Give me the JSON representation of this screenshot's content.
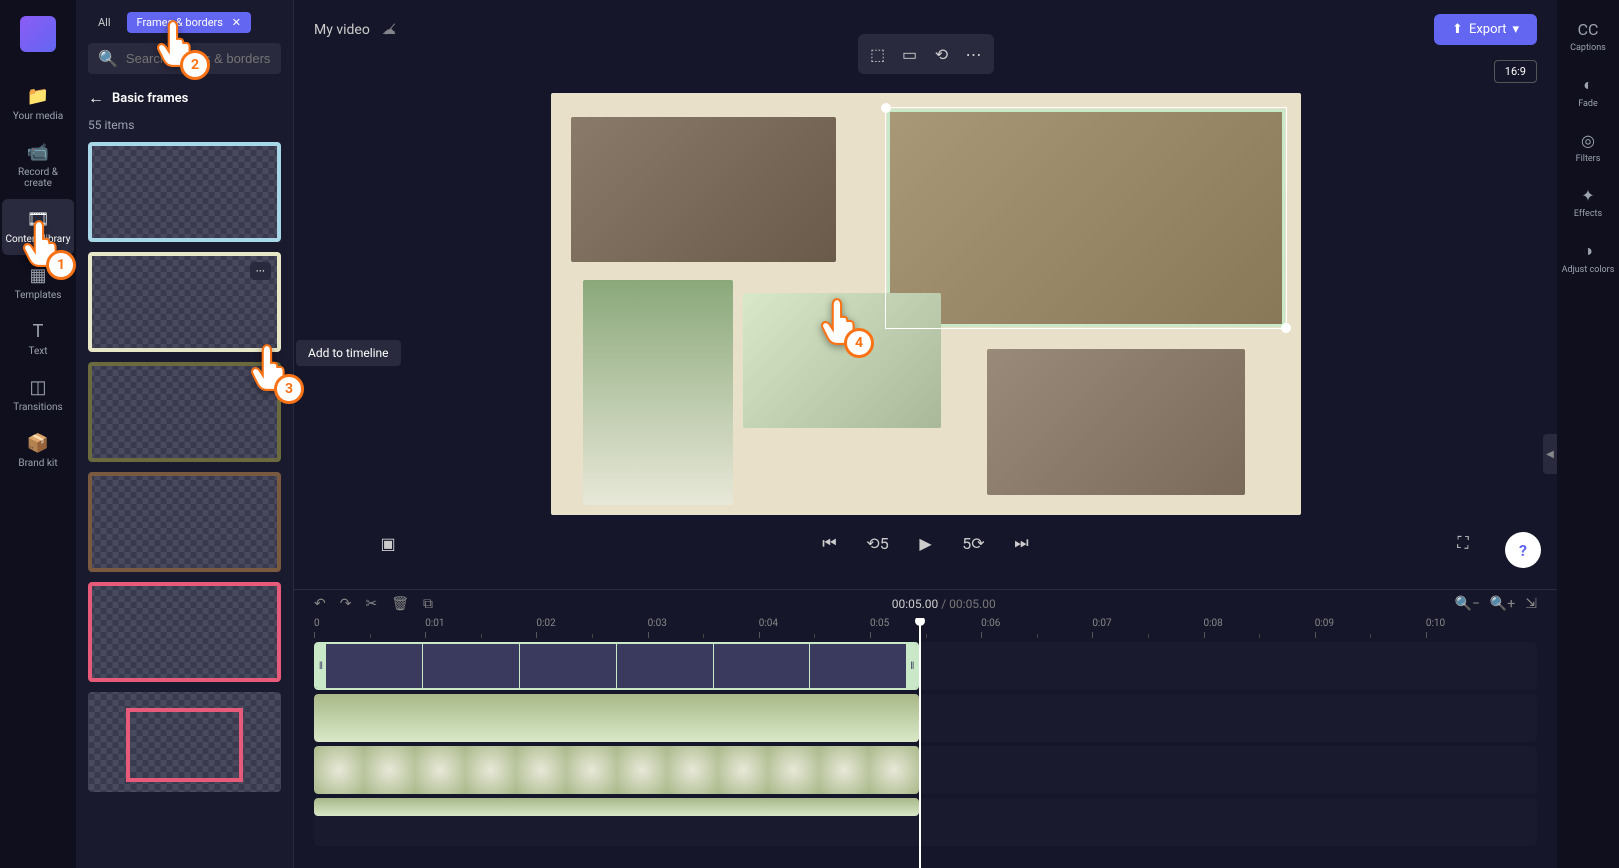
{
  "leftNav": {
    "your_media": "Your media",
    "record_create": "Record & create",
    "content_library": "Content library",
    "templates": "Templates",
    "text": "Text",
    "transitions": "Transitions",
    "brand_kit": "Brand kit"
  },
  "panel": {
    "tab_all": "All",
    "tab_frames": "Frames & borders",
    "search_placeholder": "Search frames & borders",
    "breadcrumb": "Basic frames",
    "items_count": "55 items",
    "more": "···"
  },
  "tooltip": {
    "add_to_timeline": "Add to timeline"
  },
  "topbar": {
    "title": "My video",
    "export": "Export",
    "aspect": "16:9"
  },
  "playback": {
    "current": "00:05.00",
    "total": "00:05.00"
  },
  "ruler": {
    "t0": "0",
    "t1": "0:01",
    "t2": "0:02",
    "t3": "0:03",
    "t4": "0:04",
    "t5": "0:05",
    "t6": "0:06",
    "t7": "0:07",
    "t8": "0:08",
    "t9": "0:09",
    "t10": "0:10"
  },
  "rightNav": {
    "captions": "Captions",
    "fade": "Fade",
    "filters": "Filters",
    "effects": "Effects",
    "adjust_colors": "Adjust colors"
  },
  "cursors": {
    "c1": "1",
    "c2": "2",
    "c3": "3",
    "c4": "4"
  },
  "help": "?"
}
